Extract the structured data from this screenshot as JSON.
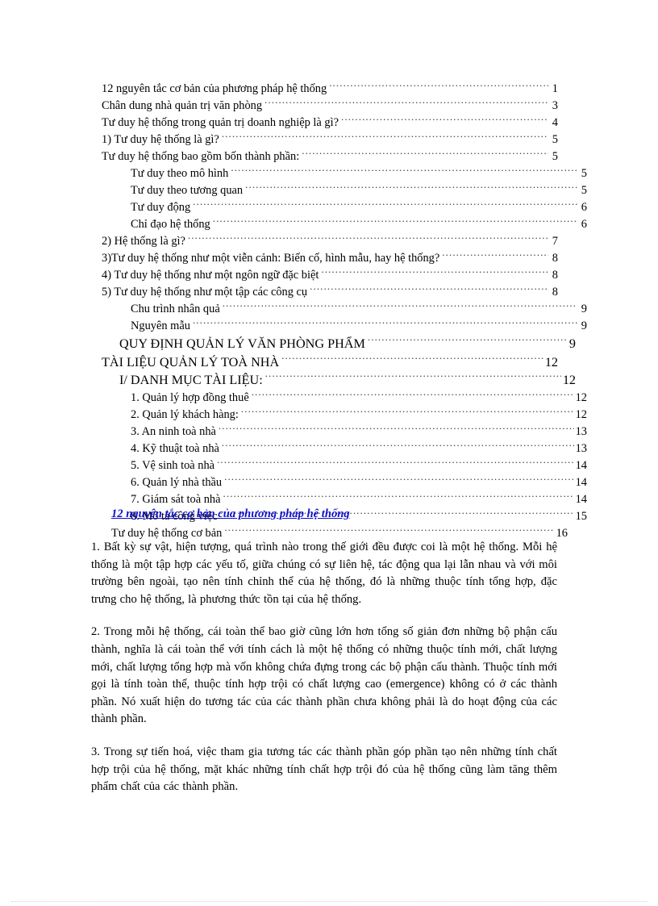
{
  "document": {
    "toc": {
      "entries": [
        {
          "label": "12 nguyên  tắc cơ bản của phương pháp hệ thống",
          "page": "1",
          "level": 0,
          "caps": false
        },
        {
          "label": "Chân dung nhà quản trị văn phòng",
          "page": "3",
          "level": 0,
          "caps": false
        },
        {
          "label": "Tư duy hệ thống trong quản trị doanh nghiệp  là gì?",
          "page": "4",
          "level": 0,
          "caps": false
        },
        {
          "label": "1) Tư duy hệ thống là gì?",
          "page": "5",
          "level": 0,
          "caps": false
        },
        {
          "label": "Tư duy hệ thống bao gồm bốn thành phần:",
          "page": "5",
          "level": 0,
          "caps": false
        },
        {
          "label": "Tư duy theo mô hình",
          "page": "5",
          "level": 2,
          "caps": false
        },
        {
          "label": "Tư duy theo tương  quan",
          "page": "5",
          "level": 2,
          "caps": false
        },
        {
          "label": "Tư duy động",
          "page": "6",
          "level": 2,
          "caps": false
        },
        {
          "label": "Chỉ đạo hệ thống",
          "page": "6",
          "level": 2,
          "caps": false
        },
        {
          "label": "2) Hệ thống là gì?",
          "page": "7",
          "level": 0,
          "caps": false
        },
        {
          "label": "3)Tư duy hệ thống như một viễn  cảnh: Biến  cố, hình  mẫu, hay hệ thống?",
          "page": "8",
          "level": 0,
          "caps": false
        },
        {
          "label": "4) Tư duy hệ thống như một ngôn  ngữ  đặc biệt",
          "page": "8",
          "level": 0,
          "caps": false
        },
        {
          "label": "5) Tư duy hệ thống như một tập các công cụ",
          "page": "8",
          "level": 0,
          "caps": false
        },
        {
          "label": "Chu trình  nhân  quả",
          "page": "9",
          "level": 2,
          "caps": false
        },
        {
          "label": "Nguyên  mẫu",
          "page": "9",
          "level": 2,
          "caps": false
        },
        {
          "label": "QUY ĐỊNH QUẢN LÝ VĂN PHÒNG PHẨM",
          "page": "9",
          "level": 3,
          "caps": true
        },
        {
          "label": "TÀI LIỆU QUẢN LÝ TOÀ NHÀ",
          "page": "12",
          "level": 0,
          "caps": true
        },
        {
          "label": "I/ DANH MỤC TÀI LIỆU:",
          "page": "12",
          "level": 3,
          "caps": true
        },
        {
          "label": "1. Quản lý hợp  đồng thuê",
          "page": "12",
          "level": 2,
          "caps": false
        },
        {
          "label": "2. Quản lý khách hàng:",
          "page": "12",
          "level": 2,
          "caps": false
        },
        {
          "label": "3. An ninh  toà nhà",
          "page": "13",
          "level": 2,
          "caps": false
        },
        {
          "label": "4. Kỹ thuật toà nhà",
          "page": "13",
          "level": 2,
          "caps": false
        },
        {
          "label": "5. Vệ sinh  toà nhà",
          "page": "14",
          "level": 2,
          "caps": false
        },
        {
          "label": "6. Quản lý nhà thầu",
          "page": "14",
          "level": 2,
          "caps": false
        },
        {
          "label": "7. Giám  sát toà nhà",
          "page": "14",
          "level": 2,
          "caps": false
        },
        {
          "label": "8. Mô tả công việc",
          "page": "15",
          "level": 2,
          "caps": false
        },
        {
          "label": "Tư duy hệ thống  cơ bản",
          "page": "16",
          "level": 1,
          "caps": false
        }
      ]
    },
    "section_heading": {
      "text": "12 nguyên tắc cơ bản của phương pháp hệ thống",
      "color": "#1111cc"
    },
    "paragraphs": [
      "1. Bất kỳ sự vật, hiện  tượng,  quá trình nào trong thế giới  đều được coi là một hệ thống. Mỗi hệ thống là một tập hợp các yếu tố, giữa chúng có sự liên  hệ, tác động qua lại lẫn nhau và với môi trường bên ngoài, tạo nên tính  chỉnh  thể của hệ thống,  đó là những  thuộc tính  tổng hợp, đặc trưng cho hệ thống, là phương thức tồn tại của hệ thống.",
      "2. Trong mỗi hệ thống,  cái toàn thể bao giờ cũng lớn hơn tổng số giản  đơn những bộ phận cấu thành,  nghĩa  là cái toàn thể với tính  cách là một hệ thống  có những  thuộc tính mới, chất lượng mới, chất lượng tổng hợp mà vốn không chứa đựng trong  các bộ phận cấu thành.  Thuộc  tính mới gọi là tính  toàn thể, thuộc tính hợp trội có chất lượng cao (emergence)  không có ở các thành  phần. Nó xuất  hiện  do tương tác của các thành  phần chưa không phải là do hoạt động của các thành  phần.",
      "3. Trong sự tiến hoá, việc  tham  gia tương tác các thành  phần góp phần tạo nên những  tính chất hợp trội của hệ thống,  mặt khác những  tính  chất hợp trội đó của hệ thống  cũng làm tăng thêm phẩm chất của các thành  phần."
    ],
    "footer": {
      "rule_color": "#e8c8cd"
    }
  }
}
